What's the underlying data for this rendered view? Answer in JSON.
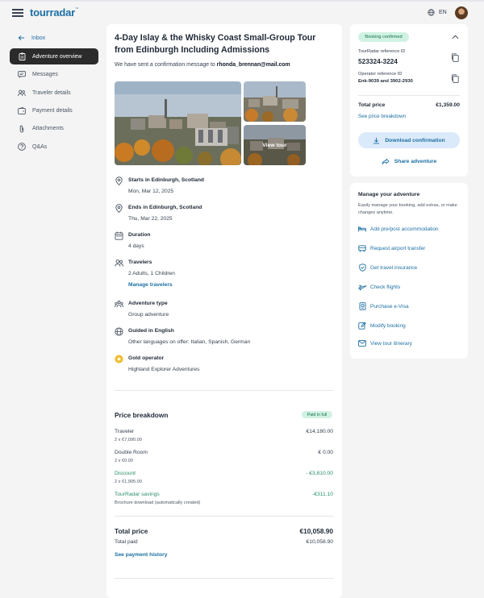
{
  "header": {
    "logo": "tourradar",
    "logo_tm": "™",
    "language": "EN"
  },
  "sidebar": {
    "back_label": "Inbox",
    "items": [
      {
        "label": "Adventure overview",
        "icon": "clipboard-icon",
        "active": true
      },
      {
        "label": "Messages",
        "icon": "message-icon",
        "active": false
      },
      {
        "label": "Traveler details",
        "icon": "users-icon",
        "active": false
      },
      {
        "label": "Payment details",
        "icon": "wallet-icon",
        "active": false
      },
      {
        "label": "Attachments",
        "icon": "paperclip-icon",
        "active": false
      },
      {
        "label": "Q&As",
        "icon": "question-icon",
        "active": false
      }
    ]
  },
  "main": {
    "title": "4-Day Islay & the Whisky Coast Small-Group Tour from Edinburgh Including Admissions",
    "confirmation_prefix": "We have sent a confirmation message to",
    "confirmation_email": "rhonda_brennan@mail.com",
    "view_tour_label": "View tour",
    "details": {
      "start": {
        "title": "Starts in Edinburgh, Scotland",
        "sub": "Mon, Mar 12, 2025"
      },
      "end": {
        "title": "Ends in Edinburgh, Scotland",
        "sub": "Thu, Mar 22, 2025"
      },
      "duration": {
        "title": "Duration",
        "sub": "4 days"
      },
      "travelers": {
        "title": "Travelers",
        "sub": "2 Adults, 1 Children",
        "link": "Manage travelers"
      },
      "adventure_type": {
        "title": "Adventure type",
        "sub": "Group adventure"
      },
      "guided": {
        "title": "Guided in English",
        "sub": "Other languages on offer: Italian, Spanish, German"
      },
      "operator": {
        "title": "Gold operator",
        "sub": "Highland Explorer Adventures"
      }
    },
    "price_breakdown": {
      "title": "Price breakdown",
      "badge": "Paid in full",
      "rows": [
        {
          "label": "Traveler",
          "sub": "2 x  €7,090.00",
          "amount": "€14,180.00"
        },
        {
          "label": "Double Room",
          "sub": "2 x €0.00",
          "amount": "€ 0.00"
        },
        {
          "label": "Discount",
          "sub": "2 x €1,905.00",
          "amount": "- €3,810.00"
        },
        {
          "label": "TourRadar savings",
          "sub": "Brochure download (automatically created)",
          "amount": "-€311.10"
        }
      ],
      "total_label": "Total price",
      "total_amount": "€10,058.90",
      "total_paid_label": "Total paid",
      "total_paid_amount": "€10,058.90",
      "payment_history_link": "See payment history"
    }
  },
  "booking_card": {
    "status_badge": "Booking confirmed",
    "tourradar_ref_label": "TourRadar reference ID",
    "tourradar_ref_value": "523324-3224",
    "operator_ref_label": "Operator reference ID",
    "operator_ref_value": "Enk-9039 and 3902-2930",
    "total_price_label": "Total price",
    "total_price_value": "€1,359.00",
    "price_breakdown_link": "See price breakdown",
    "download_button": "Download confirmation",
    "share_button": "Share adventure"
  },
  "manage_card": {
    "title": "Manage your adventure",
    "subtitle": "Easily manage your booking, add extras, or make changes anytime.",
    "links": [
      {
        "label": "Add pre/post accommodation",
        "icon": "bed-icon"
      },
      {
        "label": "Request airport transfer",
        "icon": "bus-icon"
      },
      {
        "label": "Get travel insurance",
        "icon": "shield-check-icon"
      },
      {
        "label": "Check flights",
        "icon": "plane-icon"
      },
      {
        "label": "Purchase e-Visa",
        "icon": "passport-icon"
      },
      {
        "label": "Modify booking",
        "icon": "edit-booking-icon"
      },
      {
        "label": "View tour itinerary",
        "icon": "mail-icon"
      }
    ]
  },
  "colors": {
    "accent": "#1c6fa3",
    "success_bg": "#d1f2e3",
    "success_text": "#16704d",
    "discount": "#2a9068",
    "sidebar_active": "#2b2b2b"
  }
}
